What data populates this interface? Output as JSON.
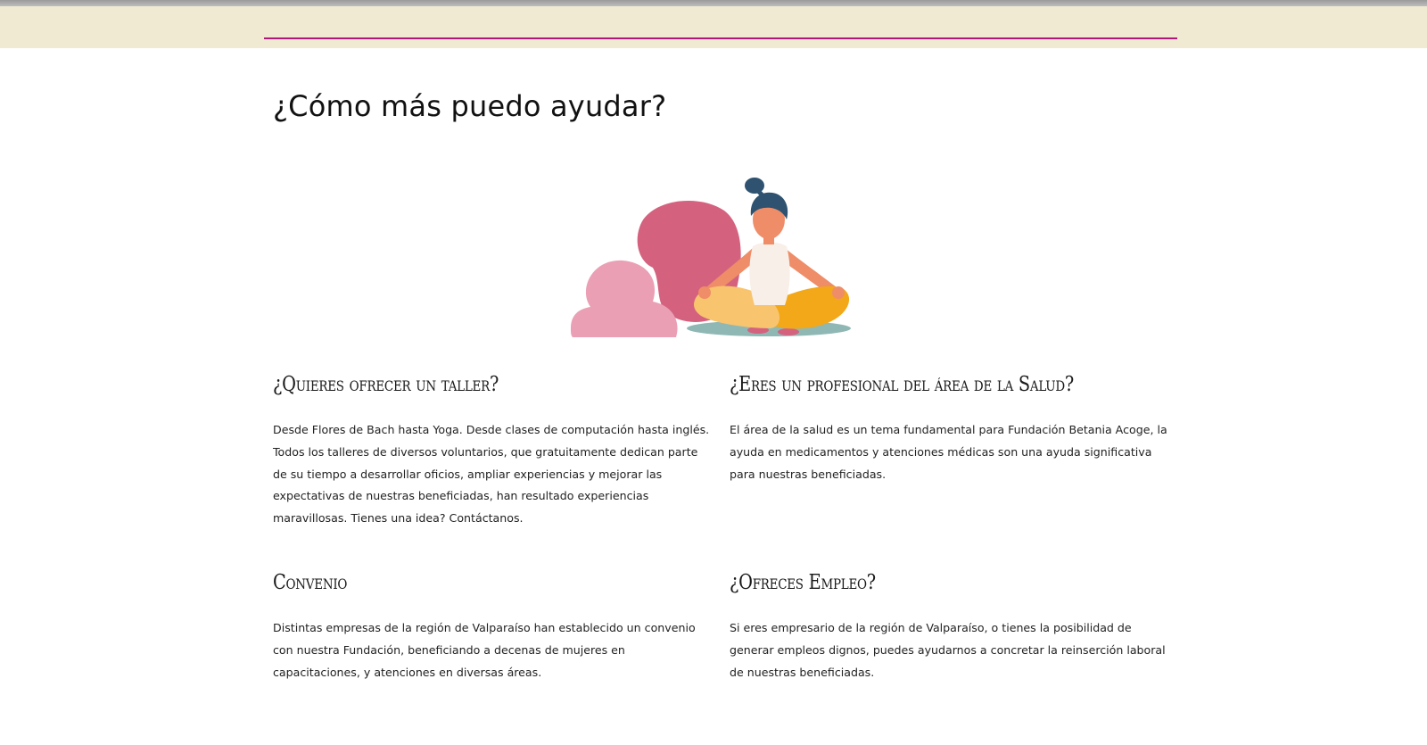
{
  "page": {
    "title": "¿Cómo más puedo ayudar?"
  },
  "colors": {
    "header_band": "#f1ead2",
    "header_rule": "#b3167a",
    "blob_dark_pink": "#d4627f",
    "blob_light_pink": "#eb9fb5",
    "hair": "#2e5270",
    "skin": "#ee8d68",
    "shirt": "#f7efe8",
    "pants_light": "#f8c46e",
    "pants_dark": "#f2a818",
    "mat": "#8fb8b5"
  },
  "illustration": {
    "icon": "meditating-woman-illustration"
  },
  "sections": [
    {
      "title": "¿Quieres ofrecer un taller?",
      "text": "Desde Flores de Bach hasta Yoga. Desde clases de computación hasta inglés. Todos los talleres de diversos voluntarios, que gratuitamente dedican parte de su tiempo a desarrollar oficios, ampliar experiencias y mejorar las expectativas de nuestras beneficiadas, han resultado experiencias maravillosas. Tienes una idea? Contáctanos."
    },
    {
      "title": "¿Eres un profesional del área de la Salud?",
      "text": "El área de la salud es un tema fundamental para Fundación Betania Acoge, la ayuda en medicamentos y atenciones médicas son una ayuda significativa para nuestras beneficiadas."
    },
    {
      "title": "Convenio",
      "text": "Distintas empresas de la región de Valparaíso han establecido un convenio con nuestra Fundación, beneficiando a decenas de mujeres en capacitaciones, y atenciones en diversas áreas."
    },
    {
      "title": "¿Ofreces Empleo?",
      "text": "Si eres empresario de la región de Valparaíso, o tienes la posibilidad de generar empleos dignos, puedes ayudarnos a concretar la reinserción laboral de nuestras beneficiadas."
    }
  ]
}
